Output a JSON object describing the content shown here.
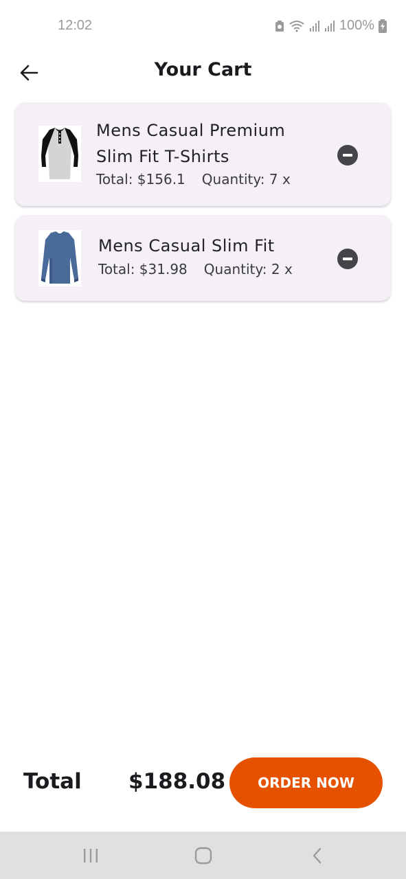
{
  "status_bar": {
    "time": "12:02",
    "battery": "100%"
  },
  "app_bar": {
    "title": "Your Cart"
  },
  "cart_items": [
    {
      "title": "Mens Casual Premium Slim Fit T-Shirts",
      "total": "Total: $156.1",
      "quantity": "Quantity: 7 x",
      "image_icon": "raglan-henley-shirt-image"
    },
    {
      "title": "Mens Casual Slim Fit",
      "total": "Total: $31.98",
      "quantity": "Quantity: 2 x",
      "image_icon": "blue-long-sleeve-shirt-image"
    }
  ],
  "footer": {
    "total_label": "Total",
    "total_value": "$188.08",
    "order_button": "ORDER NOW"
  },
  "colors": {
    "accent": "#e65100",
    "card_background": "#f5f0f8",
    "remove_icon": "#454549",
    "nav_bar": "#e0e0e0"
  }
}
